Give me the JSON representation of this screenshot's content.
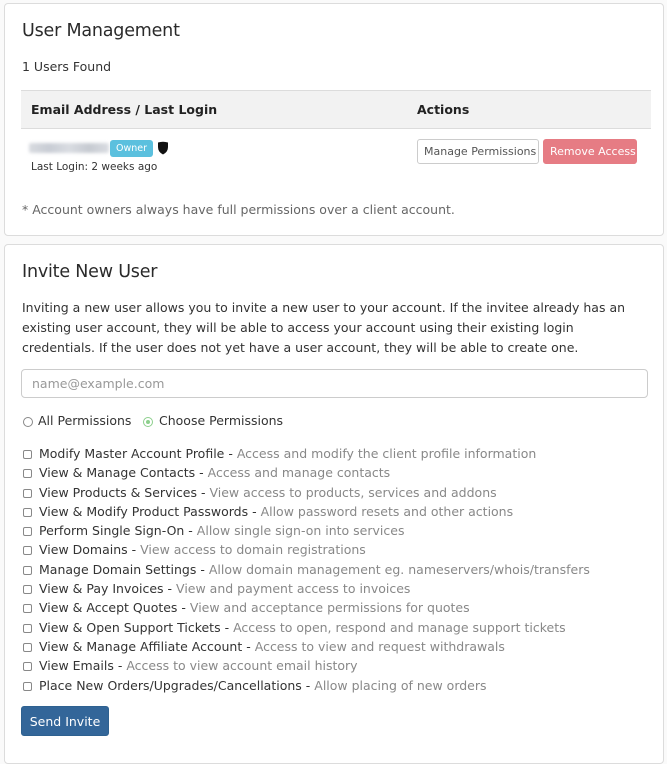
{
  "user_management": {
    "title": "User Management",
    "users_found": "1 Users Found",
    "table": {
      "headers": [
        "Email Address / Last Login",
        "Actions"
      ],
      "rows": [
        {
          "email": "(blurred)",
          "badge": "Owner",
          "icon": "shield-icon",
          "last_login": "Last Login: 2 weeks ago",
          "actions": [
            "Manage Permissions",
            "Remove Access"
          ]
        }
      ]
    },
    "footnote": "* Account owners always have full permissions over a client account."
  },
  "invite": {
    "title": "Invite New User",
    "intro": "Inviting a new user allows you to invite a new user to your account. If the invitee already has an existing user account, they will be able to access your account using their existing login credentials. If the user does not yet have a user account, they will be able to create one.",
    "email_input": {
      "value": "",
      "placeholder": "name@example.com"
    },
    "permission_mode": {
      "options": [
        "All Permissions",
        "Choose Permissions"
      ],
      "selected": "Choose Permissions"
    },
    "permissions": [
      {
        "name": "Modify Master Account Profile",
        "desc": "Access and modify the client profile information",
        "checked": false
      },
      {
        "name": "View & Manage Contacts",
        "desc": "Access and manage contacts",
        "checked": false
      },
      {
        "name": "View Products & Services",
        "desc": "View access to products, services and addons",
        "checked": false
      },
      {
        "name": "View & Modify Product Passwords",
        "desc": "Allow password resets and other actions",
        "checked": false
      },
      {
        "name": "Perform Single Sign-On",
        "desc": "Allow single sign-on into services",
        "checked": false
      },
      {
        "name": "View Domains",
        "desc": "View access to domain registrations",
        "checked": false
      },
      {
        "name": "Manage Domain Settings",
        "desc": "Allow domain management eg. nameservers/whois/transfers",
        "checked": false
      },
      {
        "name": "View & Pay Invoices",
        "desc": "View and payment access to invoices",
        "checked": false
      },
      {
        "name": "View & Accept Quotes",
        "desc": "View and acceptance permissions for quotes",
        "checked": false
      },
      {
        "name": "View & Open Support Tickets",
        "desc": "Access to open, respond and manage support tickets",
        "checked": false
      },
      {
        "name": "View & Manage Affiliate Account",
        "desc": "Access to view and request withdrawals",
        "checked": false
      },
      {
        "name": "View Emails",
        "desc": "Access to view account email history",
        "checked": false
      },
      {
        "name": "Place New Orders/Upgrades/Cancellations",
        "desc": "Allow placing of new orders",
        "checked": false
      }
    ],
    "separator": " - ",
    "send_label": "Send Invite"
  },
  "colors": {
    "owner_badge": "#5bc0de",
    "remove_button": "#e67c84",
    "send_button": "#336699",
    "radio_selected": "#8ccf8c"
  }
}
